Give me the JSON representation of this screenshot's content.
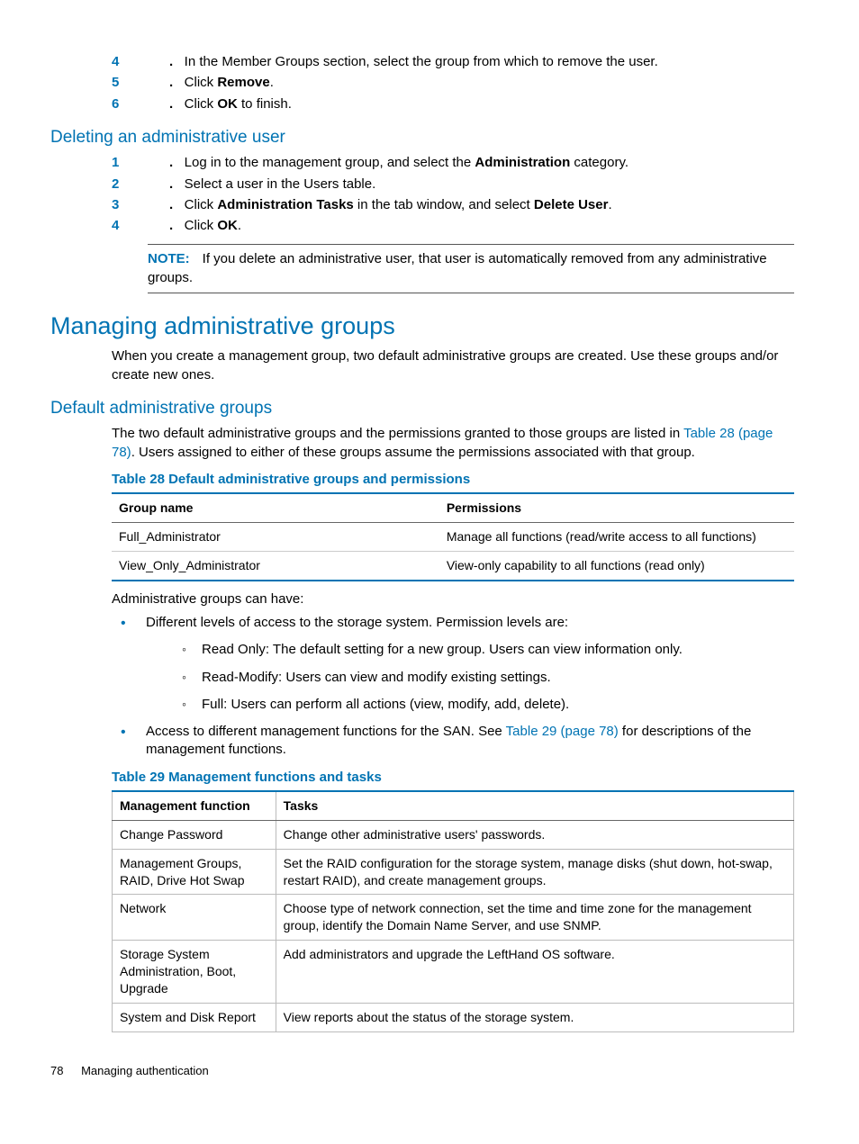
{
  "top_list": [
    {
      "n": "4",
      "pre": "In the Member Groups section, select the group from which to remove the user."
    },
    {
      "n": "5",
      "pre": "Click ",
      "bold": "Remove",
      "post": "."
    },
    {
      "n": "6",
      "pre": "Click ",
      "bold": "OK",
      "post": " to finish."
    }
  ],
  "h_del": "Deleting an administrative user",
  "del_list": {
    "i1": {
      "n": "1",
      "a": "Log in to the management group, and select the ",
      "b": "Administration",
      "c": " category."
    },
    "i2": {
      "n": "2",
      "a": "Select a user in the Users table."
    },
    "i3": {
      "n": "3",
      "a": "Click ",
      "b": "Administration Tasks",
      "c": " in the tab window, and select ",
      "d": "Delete User",
      "e": "."
    },
    "i4": {
      "n": "4",
      "a": "Click ",
      "b": "OK",
      "c": "."
    }
  },
  "note_label": "NOTE:",
  "note_body": "If you delete an administrative user, that user is automatically removed from any administrative groups.",
  "h_main": "Managing administrative groups",
  "p_main": "When you create a management group, two default administrative groups are created. Use these groups and/or create new ones.",
  "h_default": "Default administrative groups",
  "p_default_a": "The two default administrative groups and the permissions granted to those groups are listed in ",
  "p_default_link": "Table 28 (page 78)",
  "p_default_b": ". Users assigned to either of these groups assume the permissions associated with that group.",
  "t28_caption": "Table 28 Default administrative groups and permissions",
  "t28": {
    "h1": "Group name",
    "h2": "Permissions",
    "r1c1": "Full_Administrator",
    "r1c2": "Manage all functions (read/write access to all functions)",
    "r2c1": "View_Only_Administrator",
    "r2c2": "View-only capability to all functions (read only)"
  },
  "p_can_have": "Administrative groups can have:",
  "b1": "Different levels of access to the storage system. Permission levels are:",
  "sb1": "Read Only: The default setting for a new group. Users can view information only.",
  "sb2": "Read-Modify: Users can view and modify existing settings.",
  "sb3": "Full: Users can perform all actions (view, modify, add, delete).",
  "b2a": "Access to different management functions for the SAN. See ",
  "b2link": "Table 29 (page 78)",
  "b2b": " for descriptions of the management functions.",
  "t29_caption": "Table 29 Management functions and tasks",
  "t29": {
    "h1": "Management function",
    "h2": "Tasks",
    "r1c1": "Change Password",
    "r1c2": "Change other administrative users' passwords.",
    "r2c1": "Management Groups, RAID, Drive Hot Swap",
    "r2c2": "Set the RAID configuration for the storage system, manage disks (shut down, hot-swap, restart RAID), and create management groups.",
    "r3c1": "Network",
    "r3c2": "Choose type of network connection, set the time and time zone for the management group, identify the Domain Name Server, and use SNMP.",
    "r4c1": "Storage System Administration, Boot, Upgrade",
    "r4c2": "Add administrators and upgrade the LeftHand OS software.",
    "r5c1": "System and Disk Report",
    "r5c2": "View reports about the status of the storage system."
  },
  "footer_page": "78",
  "footer_title": "Managing authentication"
}
